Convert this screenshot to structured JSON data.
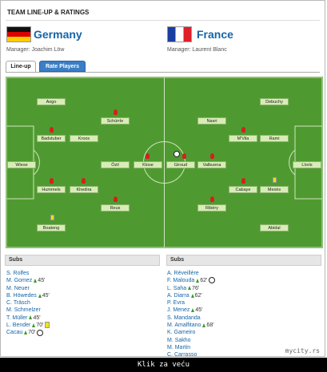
{
  "header": {
    "title": "TEAM LINE-UP & RATINGS"
  },
  "teams": {
    "home": {
      "name": "Germany",
      "manager": "Manager: Joachim Löw"
    },
    "away": {
      "name": "France",
      "manager": "Manager: Laurent Blanc"
    }
  },
  "tabs": {
    "lineup": "Line-up",
    "rate": "Rate Players"
  },
  "pitch": {
    "home_players": [
      "Wiese",
      "Badstuber",
      "Hummels",
      "Boateng",
      "Aogo",
      "Kroos",
      "Khedira",
      "Schürrle",
      "Özil",
      "Reus",
      "Klose"
    ],
    "away_players": [
      "Lloris",
      "Debuchy",
      "Rami",
      "Mexès",
      "Abidal",
      "M'Vila",
      "Cabaye",
      "Nasri",
      "Valbuena",
      "Ribéry",
      "Giroud"
    ]
  },
  "subs": {
    "label": "Subs",
    "home": [
      {
        "name": "S. Rolfes",
        "min": ""
      },
      {
        "name": "M. Gomez",
        "min": "45'",
        "up": true
      },
      {
        "name": "M. Neuer",
        "min": ""
      },
      {
        "name": "B. Höwedes",
        "min": "45'",
        "up": true
      },
      {
        "name": "C. Träsch",
        "min": ""
      },
      {
        "name": "M. Schmelzer",
        "min": ""
      },
      {
        "name": "T. Müller",
        "min": "45'",
        "up": true
      },
      {
        "name": "L. Bender",
        "min": "70'",
        "up": true,
        "card": true
      },
      {
        "name": "Cacau",
        "min": "70'",
        "up": true,
        "goal": true
      }
    ],
    "away": [
      {
        "name": "A. Réveillère",
        "min": ""
      },
      {
        "name": "F. Malouda",
        "min": "62'",
        "up": true,
        "goal": true
      },
      {
        "name": "L. Saha",
        "min": "76'",
        "up": true
      },
      {
        "name": "A. Diarra",
        "min": "62'",
        "up": true
      },
      {
        "name": "P. Evra",
        "min": ""
      },
      {
        "name": "J. Menez",
        "min": "45'",
        "up": true
      },
      {
        "name": "S. Mandanda",
        "min": ""
      },
      {
        "name": "M. Amalfitano",
        "min": "68'",
        "up": true
      },
      {
        "name": "K. Gameiro",
        "min": ""
      },
      {
        "name": "M. Sakho",
        "min": ""
      },
      {
        "name": "M. Martin",
        "min": ""
      },
      {
        "name": "C. Carrasso",
        "min": ""
      }
    ]
  },
  "watermark": "mycity.rs",
  "caption": "Klik za veću"
}
